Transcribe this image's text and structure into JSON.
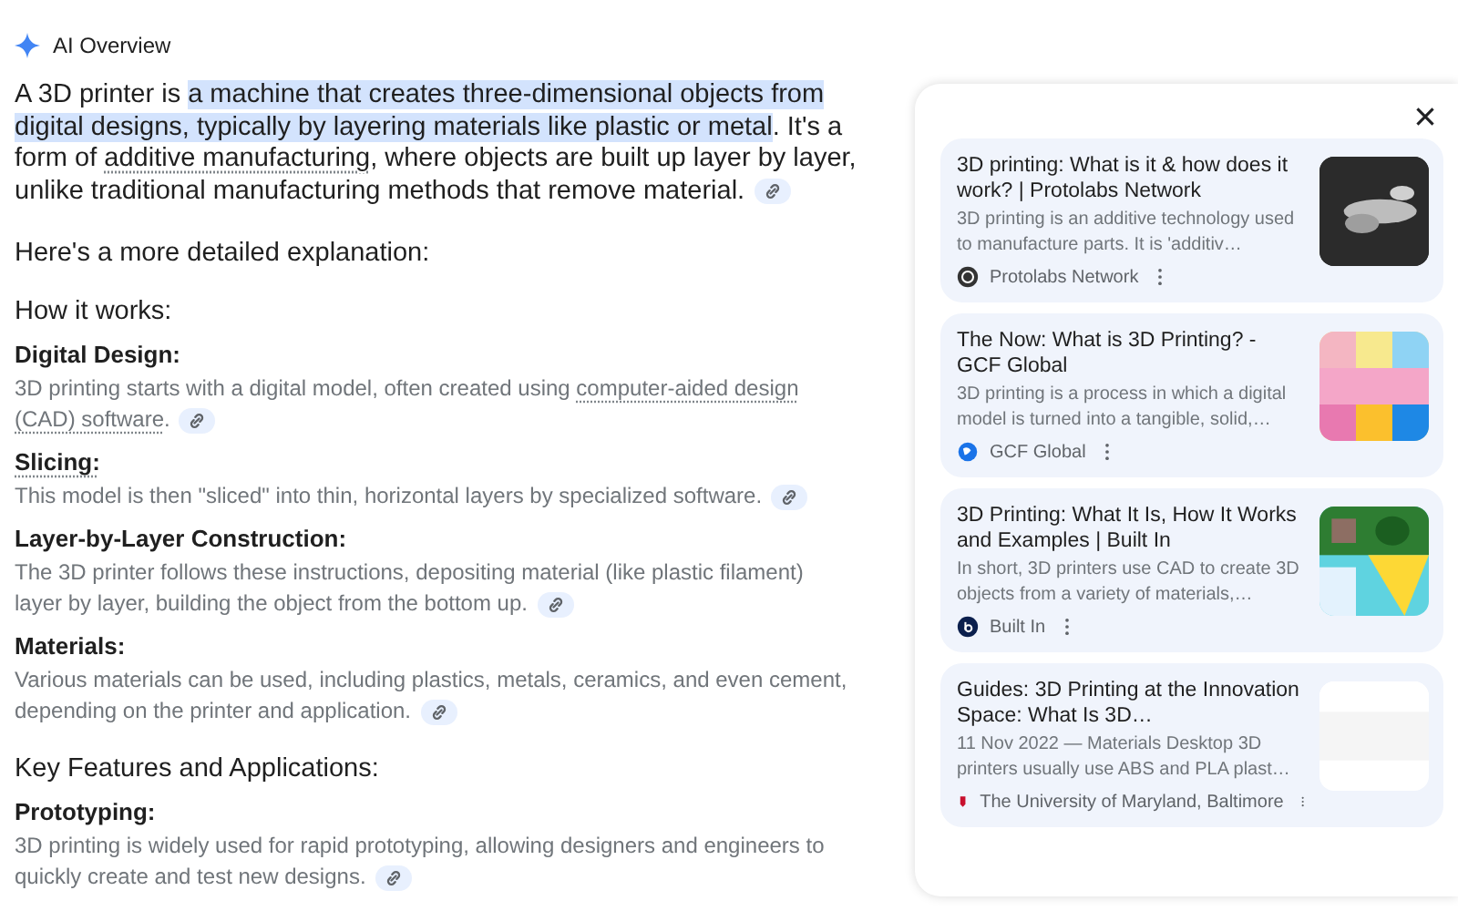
{
  "header": {
    "title": "AI Overview"
  },
  "intro": [
    {
      "text": "A 3D printer is ",
      "kind": "plain"
    },
    {
      "text": "a machine that creates three-dimensional objects from digital designs, typically by layering materials like plastic or metal",
      "kind": "highlight"
    },
    {
      "text": ". It's a form of ",
      "kind": "plain"
    },
    {
      "text": "additive manufacturing",
      "kind": "term"
    },
    {
      "text": ", where objects are built up layer by layer, unlike traditional manufacturing methods that remove material.",
      "kind": "plain"
    }
  ],
  "lead": "Here's a more detailed explanation:",
  "sections": [
    {
      "heading": "How it works:",
      "items": [
        {
          "title": "Digital Design:",
          "title_term": false,
          "text": [
            {
              "text": "3D printing starts with a digital model, often created using ",
              "kind": "plain"
            },
            {
              "text": "computer-aided design (CAD) software",
              "kind": "term"
            },
            {
              "text": ".",
              "kind": "plain"
            }
          ]
        },
        {
          "title": "Slicing:",
          "title_term": true,
          "text": [
            {
              "text": "This model is then \"sliced\" into thin, horizontal layers by specialized software.",
              "kind": "plain"
            }
          ]
        },
        {
          "title": "Layer-by-Layer Construction:",
          "title_term": false,
          "text": [
            {
              "text": "The 3D printer follows these instructions, depositing material (like plastic filament) layer by layer, building the object from the bottom up.",
              "kind": "plain"
            }
          ]
        },
        {
          "title": "Materials:",
          "title_term": false,
          "text": [
            {
              "text": "Various materials can be used, including plastics, metals, ceramics, and even cement, depending on the printer and application.",
              "kind": "plain"
            }
          ]
        }
      ]
    },
    {
      "heading": "Key Features and Applications:",
      "items": [
        {
          "title": "Prototyping:",
          "title_term": false,
          "text": [
            {
              "text": "3D printing is widely used for rapid prototyping, allowing designers and engineers to quickly create and test new designs.",
              "kind": "plain"
            }
          ]
        }
      ]
    }
  ],
  "sources": [
    {
      "title": "3D printing: What is it & how does it work? | Protolabs Network",
      "snippet": "3D printing is an additive technology used to manufacture parts. It is 'additiv…",
      "site": "Protolabs Network",
      "color": "#333333",
      "kind": "picture"
    },
    {
      "title": "The Now: What is 3D Printing? - GCF Global",
      "snippet": "3D printing is a process in which a digital model is turned into a tangible, solid,…",
      "site": "GCF Global",
      "color": "#1a73e8",
      "kind": "picture"
    },
    {
      "title": "3D Printing: What It Is, How It Works and Examples | Built In",
      "snippet": "In short, 3D printers use CAD to create 3D objects from a variety of materials,…",
      "site": "Built In",
      "color": "#0b1f4d",
      "kind": "picture"
    },
    {
      "title": "Guides: 3D Printing at the Innovation Space: What Is 3D…",
      "snippet": "11 Nov 2022 — Materials Desktop 3D printers usually use ABS and PLA plast…",
      "site": "The University of Maryland, Baltimore",
      "color": "#c8102e",
      "kind": "picture"
    }
  ]
}
